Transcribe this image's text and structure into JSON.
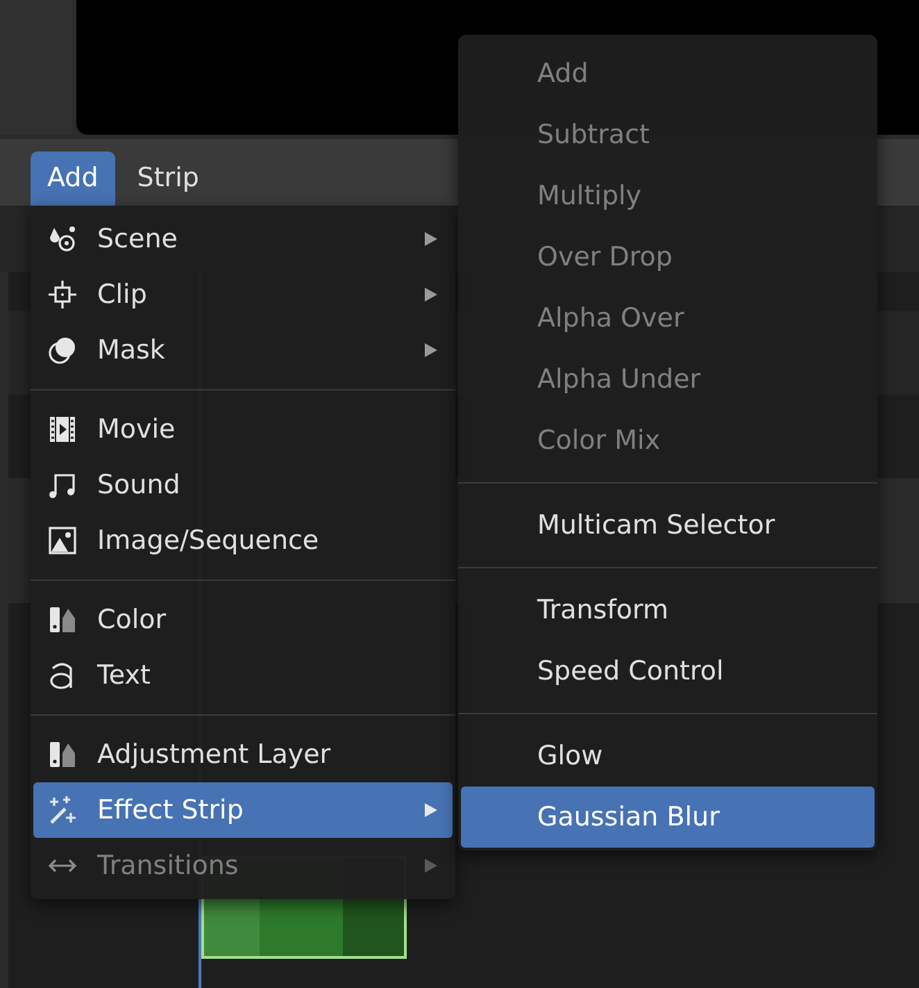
{
  "header_menu": [
    {
      "label": "Add",
      "selected": true
    },
    {
      "label": "Strip",
      "selected": false
    }
  ],
  "add_menu": {
    "sections": [
      {
        "items": [
          {
            "label": "Scene",
            "has_submenu": true,
            "disabled": false,
            "selected": false
          },
          {
            "label": "Clip",
            "has_submenu": true,
            "disabled": false,
            "selected": false
          },
          {
            "label": "Mask",
            "has_submenu": true,
            "disabled": false,
            "selected": false
          }
        ]
      },
      {
        "items": [
          {
            "label": "Movie",
            "has_submenu": false,
            "disabled": false,
            "selected": false
          },
          {
            "label": "Sound",
            "has_submenu": false,
            "disabled": false,
            "selected": false
          },
          {
            "label": "Image/Sequence",
            "has_submenu": false,
            "disabled": false,
            "selected": false
          }
        ]
      },
      {
        "items": [
          {
            "label": "Color",
            "has_submenu": false,
            "disabled": false,
            "selected": false
          },
          {
            "label": "Text",
            "has_submenu": false,
            "disabled": false,
            "selected": false
          }
        ]
      },
      {
        "items": [
          {
            "label": "Adjustment Layer",
            "has_submenu": false,
            "disabled": false,
            "selected": false
          },
          {
            "label": "Effect Strip",
            "has_submenu": true,
            "disabled": false,
            "selected": true
          },
          {
            "label": "Transitions",
            "has_submenu": true,
            "disabled": true,
            "selected": false
          }
        ]
      }
    ]
  },
  "effect_submenu": {
    "sections": [
      {
        "items": [
          {
            "label": "Add",
            "disabled": true,
            "selected": false
          },
          {
            "label": "Subtract",
            "disabled": true,
            "selected": false
          },
          {
            "label": "Multiply",
            "disabled": true,
            "selected": false
          },
          {
            "label": "Over Drop",
            "disabled": true,
            "selected": false
          },
          {
            "label": "Alpha Over",
            "disabled": true,
            "selected": false
          },
          {
            "label": "Alpha Under",
            "disabled": true,
            "selected": false
          },
          {
            "label": "Color Mix",
            "disabled": true,
            "selected": false
          }
        ]
      },
      {
        "items": [
          {
            "label": "Multicam Selector",
            "disabled": false,
            "selected": false
          }
        ]
      },
      {
        "items": [
          {
            "label": "Transform",
            "disabled": false,
            "selected": false
          },
          {
            "label": "Speed Control",
            "disabled": false,
            "selected": false
          }
        ]
      },
      {
        "items": [
          {
            "label": "Glow",
            "disabled": false,
            "selected": false
          },
          {
            "label": "Gaussian Blur",
            "disabled": false,
            "selected": true
          }
        ]
      }
    ]
  }
}
